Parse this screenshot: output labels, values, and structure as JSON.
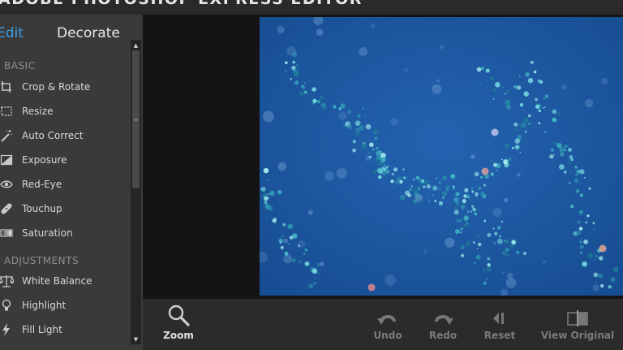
{
  "app": {
    "title": "ADOBE PHOTOSHOP EXPRESS EDITOR"
  },
  "tabs": {
    "edit": "Edit",
    "decorate": "Decorate"
  },
  "sidebar": {
    "basic_label": "BASIC",
    "basic_items": [
      {
        "label": "Crop & Rotate",
        "icon": "crop-icon"
      },
      {
        "label": "Resize",
        "icon": "resize-icon"
      },
      {
        "label": "Auto Correct",
        "icon": "magic-wand-icon"
      },
      {
        "label": "Exposure",
        "icon": "exposure-icon"
      },
      {
        "label": "Red-Eye",
        "icon": "eye-icon"
      },
      {
        "label": "Touchup",
        "icon": "bandage-icon"
      },
      {
        "label": "Saturation",
        "icon": "saturation-icon"
      }
    ],
    "adjustments_label": "ADJUSTMENTS",
    "adjustment_items": [
      {
        "label": "White Balance",
        "icon": "scale-icon"
      },
      {
        "label": "Highlight",
        "icon": "lightbulb-icon"
      },
      {
        "label": "Fill Light",
        "icon": "lightning-icon"
      }
    ]
  },
  "toolbar": {
    "zoom": "Zoom",
    "undo": "Undo",
    "redo": "Redo",
    "reset": "Reset",
    "view_original": "View Original"
  },
  "colors": {
    "accent": "#3a9ee4",
    "photo_bg": "#1d5aa6",
    "panel": "#3a3a3a"
  }
}
